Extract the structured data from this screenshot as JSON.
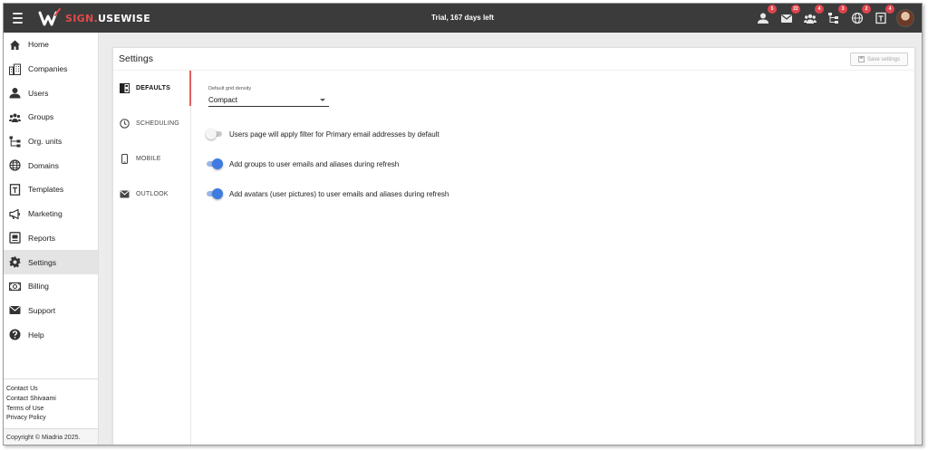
{
  "app": {
    "brand_part1": "SIGN.",
    "brand_part2": "USEWISE",
    "trial_text": "Trial, 167 days left",
    "accent_color": "#e14b4b"
  },
  "top_icons": [
    {
      "icon": "user-icon",
      "badge": "5"
    },
    {
      "icon": "mail-icon",
      "badge": "22"
    },
    {
      "icon": "group-icon",
      "badge": "4"
    },
    {
      "icon": "org-units-icon",
      "badge": "3"
    },
    {
      "icon": "globe-icon",
      "badge": "2"
    },
    {
      "icon": "template-icon",
      "badge": "4"
    }
  ],
  "sidebar": {
    "items": [
      {
        "label": "Home",
        "icon": "home-icon"
      },
      {
        "label": "Companies",
        "icon": "companies-icon"
      },
      {
        "label": "Users",
        "icon": "user-icon"
      },
      {
        "label": "Groups",
        "icon": "groups-icon"
      },
      {
        "label": "Org. units",
        "icon": "org-units-icon"
      },
      {
        "label": "Domains",
        "icon": "globe-icon"
      },
      {
        "label": "Templates",
        "icon": "template-icon"
      },
      {
        "label": "Marketing",
        "icon": "megaphone-icon"
      },
      {
        "label": "Reports",
        "icon": "reports-icon"
      },
      {
        "label": "Settings",
        "icon": "gear-icon",
        "active": true
      },
      {
        "label": "Billing",
        "icon": "billing-icon"
      },
      {
        "label": "Support",
        "icon": "mail-icon"
      },
      {
        "label": "Help",
        "icon": "help-icon"
      }
    ],
    "links": [
      "Contact Us",
      "Contact Shivaami",
      "Terms of Use",
      "Privacy Policy"
    ],
    "copyright": "Copyright © Miadria 2025."
  },
  "settings": {
    "title": "Settings",
    "save_label": "Save settings",
    "tabs": [
      {
        "label": "DEFAULTS",
        "icon": "defaults-icon",
        "active": true
      },
      {
        "label": "SCHEDULING",
        "icon": "clock-icon"
      },
      {
        "label": "MOBILE",
        "icon": "mobile-icon"
      },
      {
        "label": "OUTLOOK",
        "icon": "mail-icon"
      }
    ],
    "grid_density": {
      "label": "Default grid density",
      "value": "Compact"
    },
    "toggles": [
      {
        "label": "Users page will apply filter for Primary email addresses by default",
        "on": false
      },
      {
        "label": "Add groups to user emails and aliases during refresh",
        "on": true
      },
      {
        "label": "Add avatars (user pictures) to user emails and aliases during refresh",
        "on": true
      }
    ]
  }
}
